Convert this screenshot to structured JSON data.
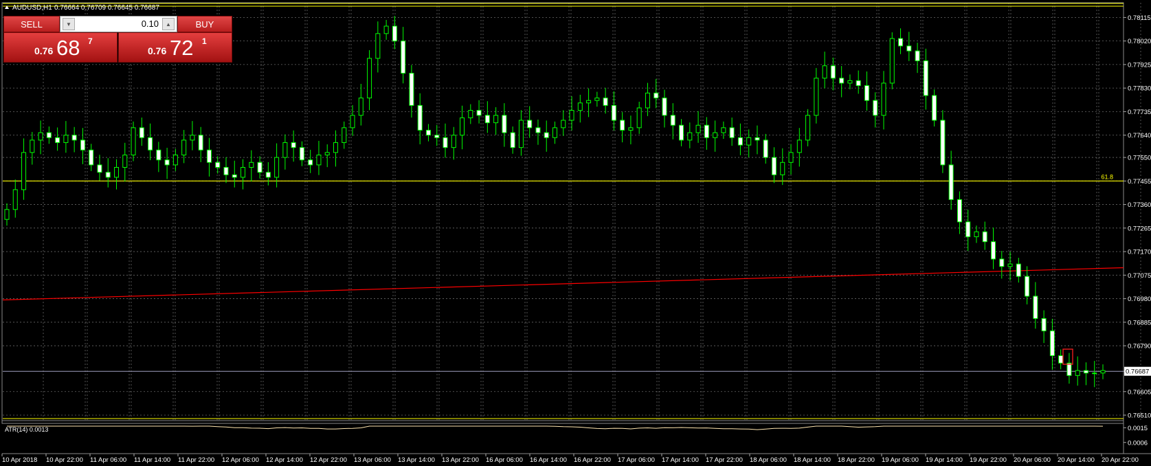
{
  "header": {
    "symbol": "AUDUSD,H1",
    "ohlc": "0.76664 0.76709 0.76645 0.76687"
  },
  "trade_panel": {
    "sell_label": "SELL",
    "buy_label": "BUY",
    "lot": "0.10",
    "sell_price_small": "0.76",
    "sell_price_big": "68",
    "sell_price_sup": "7",
    "buy_price_small": "0.76",
    "buy_price_big": "72",
    "buy_price_sup": "1"
  },
  "fib_label": "61.8",
  "indicator_label": "ATR(14) 0.0013",
  "colors": {
    "background": "#000000",
    "grid": "#6a6a6a",
    "bull_candle": "#00ff00",
    "fib_line": "#ffff00",
    "moving_average": "#ff0000",
    "atr_line": "#ffe6b0",
    "price_line": "#a0a0c0",
    "text": "#ffffff"
  },
  "chart_data": [
    {
      "type": "candlestick",
      "title": "AUDUSD,H1",
      "ylim": [
        0.7651,
        0.7813
      ],
      "y_ticks": [
        "0.78115",
        "0.78020",
        "0.77925",
        "0.77830",
        "0.77735",
        "0.77640",
        "0.77550",
        "0.77455",
        "0.77360",
        "0.77265",
        "0.77170",
        "0.77075",
        "0.76980",
        "0.76885",
        "0.76790",
        "0.76687",
        "0.76605",
        "0.76510"
      ],
      "x_ticks": [
        "10 Apr 2018",
        "10 Apr 22:00",
        "11 Apr 06:00",
        "11 Apr 14:00",
        "11 Apr 22:00",
        "12 Apr 06:00",
        "12 Apr 14:00",
        "12 Apr 22:00",
        "13 Apr 06:00",
        "13 Apr 14:00",
        "13 Apr 22:00",
        "16 Apr 06:00",
        "16 Apr 14:00",
        "16 Apr 22:00",
        "17 Apr 06:00",
        "17 Apr 14:00",
        "17 Apr 22:00",
        "18 Apr 06:00",
        "18 Apr 14:00",
        "18 Apr 22:00",
        "19 Apr 06:00",
        "19 Apr 14:00",
        "19 Apr 22:00",
        "20 Apr 06:00",
        "20 Apr 14:00",
        "20 Apr 22:00"
      ],
      "current_price": 0.76687,
      "fib_level": {
        "label": "61.8",
        "value": 0.77455
      },
      "moving_average": [
        0.76975,
        0.77105
      ],
      "close_series": [
        0.7734,
        0.7742,
        0.7757,
        0.7762,
        0.7765,
        0.7763,
        0.7761,
        0.7764,
        0.7762,
        0.7758,
        0.7752,
        0.7749,
        0.7747,
        0.7751,
        0.7756,
        0.7767,
        0.7763,
        0.7758,
        0.7754,
        0.7752,
        0.7756,
        0.7762,
        0.7764,
        0.7758,
        0.7753,
        0.7751,
        0.7748,
        0.7747,
        0.7751,
        0.7753,
        0.7749,
        0.7747,
        0.7755,
        0.7761,
        0.7759,
        0.7754,
        0.7752,
        0.7756,
        0.7757,
        0.7761,
        0.7767,
        0.7772,
        0.7779,
        0.7795,
        0.7805,
        0.7808,
        0.7802,
        0.7789,
        0.7776,
        0.7766,
        0.7764,
        0.7763,
        0.7759,
        0.7764,
        0.7771,
        0.7774,
        0.7772,
        0.7769,
        0.7772,
        0.7765,
        0.7759,
        0.777,
        0.7767,
        0.7765,
        0.7763,
        0.7767,
        0.777,
        0.7774,
        0.7777,
        0.7778,
        0.7779,
        0.7776,
        0.777,
        0.7766,
        0.7767,
        0.7775,
        0.7781,
        0.7779,
        0.7772,
        0.7768,
        0.7762,
        0.7765,
        0.7768,
        0.7763,
        0.7765,
        0.7767,
        0.7763,
        0.776,
        0.7763,
        0.7762,
        0.7755,
        0.7748,
        0.7753,
        0.7757,
        0.7762,
        0.7772,
        0.7787,
        0.7792,
        0.7787,
        0.7785,
        0.7786,
        0.7784,
        0.7778,
        0.7772,
        0.7785,
        0.7803,
        0.78,
        0.7798,
        0.7794,
        0.778,
        0.777,
        0.7752,
        0.7738,
        0.7729,
        0.7723,
        0.7725,
        0.7721,
        0.7714,
        0.7711,
        0.7712,
        0.7707,
        0.7699,
        0.769,
        0.7685,
        0.7675,
        0.7672,
        0.7667,
        0.7669,
        0.7668,
        0.7668,
        0.7669
      ],
      "series": [
        {
          "name": "AUDUSD,H1",
          "type": "candles"
        }
      ]
    },
    {
      "type": "line",
      "title": "ATR(14) 0.0013",
      "y_ticks": [
        "0.0015",
        "0.0006"
      ],
      "ylim": [
        0.0,
        0.0016
      ],
      "current_value": 0.0013
    }
  ]
}
